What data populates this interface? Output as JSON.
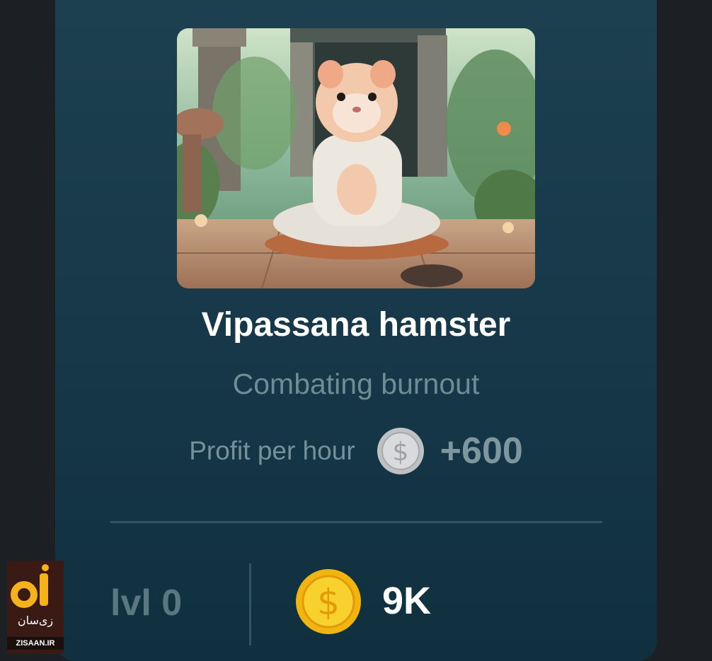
{
  "card": {
    "title": "Vipassana hamster",
    "subtitle": "Combating burnout",
    "profit_label": "Profit per hour",
    "profit_value": "+600",
    "level": "lvl 0",
    "cost": "9K"
  },
  "icons": {
    "profit_coin": "silver-dollar-coin-icon",
    "cost_coin": "gold-dollar-coin-icon"
  },
  "colors": {
    "card_top": "#1d4050",
    "card_bottom": "#10303f",
    "title": "#ffffff",
    "muted_text": "#6f8c95",
    "gold": "#f6c21c"
  },
  "watermark": {
    "logo_text": "زی‌سان",
    "site": "ZISAAN.IR"
  }
}
